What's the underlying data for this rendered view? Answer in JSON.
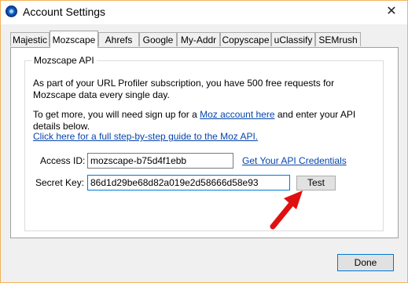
{
  "window": {
    "title": "Account Settings"
  },
  "tabs": [
    {
      "label": "Majestic"
    },
    {
      "label": "Mozscape",
      "active": true
    },
    {
      "label": "Ahrefs"
    },
    {
      "label": "Google"
    },
    {
      "label": "My-Addr"
    },
    {
      "label": "Copyscape"
    },
    {
      "label": "uClassify"
    },
    {
      "label": "SEMrush"
    }
  ],
  "group": {
    "title": "Mozscape API",
    "intro": "As part of your URL Profiler subscription, you have 500 free requests for Mozscape data every single day.",
    "signup_prefix": "To get more, you will need sign up for a ",
    "signup_link": "Moz account here",
    "signup_suffix": " and enter your API details below.",
    "guide_link": "Click here for a full step-by-step guide to the Moz API.",
    "access_id_label": "Access ID:",
    "access_id_value": "mozscape-b75d4f1ebb",
    "credentials_link": "Get Your API Credentials",
    "secret_key_label": "Secret Key:",
    "secret_key_value": "86d1d29be68d82a019e2d58666d58e93",
    "test_button": "Test"
  },
  "footer": {
    "done_button": "Done"
  },
  "colors": {
    "link": "#0645ad",
    "annotation_arrow": "#e01010",
    "window_border": "#f2b35a"
  },
  "icons": {
    "app": "app-globe-icon",
    "close": "close-icon",
    "annotation": "red-arrow-icon"
  }
}
